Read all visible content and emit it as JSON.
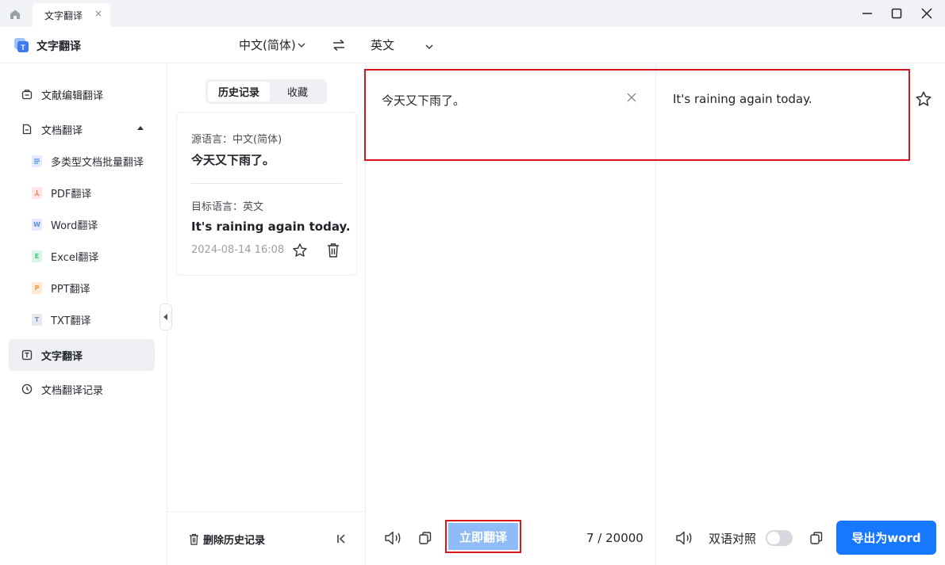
{
  "titlebar": {
    "tab_label": "文字翻译",
    "tab_close": "×"
  },
  "header": {
    "app_name": "文字翻译",
    "source_language": "中文(简体)",
    "target_language": "英文"
  },
  "sidebar": {
    "items": [
      {
        "label": "文献编辑翻译",
        "icon": "bag-icon"
      },
      {
        "label": "文档翻译",
        "icon": "document-icon"
      },
      {
        "label": "文字翻译",
        "icon": "text-icon"
      },
      {
        "label": "文档翻译记录",
        "icon": "clock-icon"
      }
    ],
    "sub_items": [
      {
        "label": "多类型文档批量翻译",
        "badge": "",
        "color": "#4a8cf7"
      },
      {
        "label": "PDF翻译",
        "badge": "",
        "color": "#f26b5b"
      },
      {
        "label": "Word翻译",
        "badge": "W",
        "color": "#5b8def"
      },
      {
        "label": "Excel翻译",
        "badge": "E",
        "color": "#3ec47b"
      },
      {
        "label": "PPT翻译",
        "badge": "P",
        "color": "#f59a3c"
      },
      {
        "label": "TXT翻译",
        "badge": "T",
        "color": "#7d8bb0"
      }
    ]
  },
  "history": {
    "tabs": [
      "历史记录",
      "收藏"
    ],
    "card": {
      "source_label": "源语言：中文(简体)",
      "source_text": "今天又下雨了。",
      "target_label": "目标语言：英文",
      "target_text": "It's raining again today.",
      "time": "2024-08-14 16:08"
    },
    "delete_label": "删除历史记录"
  },
  "editor": {
    "source_text": "今天又下雨了。",
    "target_text": "It's raining again today.",
    "translate_label": "立即翻译",
    "char_count": "7 / 20000",
    "bilingual_label": "双语对照",
    "bilingual_on": false,
    "export_label": "导出为word"
  },
  "colors": {
    "accent": "#1677ff",
    "highlight": "#d9161c",
    "translate_button": "#8fbcf6"
  }
}
